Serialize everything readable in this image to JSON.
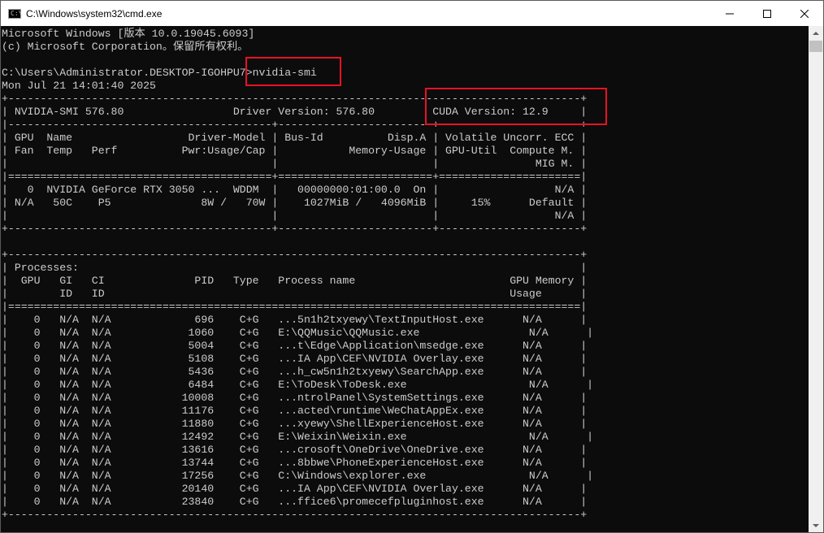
{
  "window": {
    "title": "C:\\Windows\\system32\\cmd.exe",
    "icon_text": "C:\\",
    "icons": {
      "app": "cmd-icon",
      "minimize": "minimize-icon",
      "maximize": "maximize-icon",
      "close": "close-icon"
    }
  },
  "console": {
    "lines": [
      "Microsoft Windows [版本 10.0.19045.6093]",
      "(c) Microsoft Corporation。保留所有权利。",
      "",
      "C:\\Users\\Administrator.DESKTOP-IGOHPU7>nvidia-smi",
      "Mon Jul 21 14:01:40 2025",
      "+-----------------------------------------------------------------------------------------+",
      "| NVIDIA-SMI 576.80                 Driver Version: 576.80         CUDA Version: 12.9     |",
      "|-----------------------------------------+------------------------+----------------------+",
      "| GPU  Name                  Driver-Model | Bus-Id          Disp.A | Volatile Uncorr. ECC |",
      "| Fan  Temp   Perf          Pwr:Usage/Cap |           Memory-Usage | GPU-Util  Compute M. |",
      "|                                         |                        |               MIG M. |",
      "|=========================================+========================+======================|",
      "|   0  NVIDIA GeForce RTX 3050 ...  WDDM  |   00000000:01:00.0  On |                  N/A |",
      "| N/A   50C    P5              8W /   70W |    1027MiB /   4096MiB |     15%      Default |",
      "|                                         |                        |                  N/A |",
      "+-----------------------------------------+------------------------+----------------------+",
      "",
      "+-----------------------------------------------------------------------------------------+",
      "| Processes:                                                                              |",
      "|  GPU   GI   CI              PID   Type   Process name                        GPU Memory |",
      "|        ID   ID                                                               Usage      |",
      "|=========================================================================================|",
      "|    0   N/A  N/A             696    C+G   ...5n1h2txyewy\\TextInputHost.exe      N/A      |",
      "|    0   N/A  N/A            1060    C+G   E:\\QQMusic\\QQMusic.exe                 N/A      |",
      "|    0   N/A  N/A            5004    C+G   ...t\\Edge\\Application\\msedge.exe      N/A      |",
      "|    0   N/A  N/A            5108    C+G   ...IA App\\CEF\\NVIDIA Overlay.exe      N/A      |",
      "|    0   N/A  N/A            5436    C+G   ...h_cw5n1h2txyewy\\SearchApp.exe      N/A      |",
      "|    0   N/A  N/A            6484    C+G   E:\\ToDesk\\ToDesk.exe                   N/A      |",
      "|    0   N/A  N/A           10008    C+G   ...ntrolPanel\\SystemSettings.exe      N/A      |",
      "|    0   N/A  N/A           11176    C+G   ...acted\\runtime\\WeChatAppEx.exe      N/A      |",
      "|    0   N/A  N/A           11880    C+G   ...xyewy\\ShellExperienceHost.exe      N/A      |",
      "|    0   N/A  N/A           12492    C+G   E:\\Weixin\\Weixin.exe                   N/A      |",
      "|    0   N/A  N/A           13616    C+G   ...crosoft\\OneDrive\\OneDrive.exe      N/A      |",
      "|    0   N/A  N/A           13744    C+G   ...8bbwe\\PhoneExperienceHost.exe      N/A      |",
      "|    0   N/A  N/A           17256    C+G   C:\\Windows\\explorer.exe                N/A      |",
      "|    0   N/A  N/A           20140    C+G   ...IA App\\CEF\\NVIDIA Overlay.exe      N/A      |",
      "|    0   N/A  N/A           23840    C+G   ...ffice6\\promecefpluginhost.exe      N/A      |",
      "+-----------------------------------------------------------------------------------------+"
    ]
  },
  "colors": {
    "console_background": "#0c0c0c",
    "console_text": "#cccccc",
    "highlight": "#e81123",
    "titlebar_background": "#ffffff"
  }
}
